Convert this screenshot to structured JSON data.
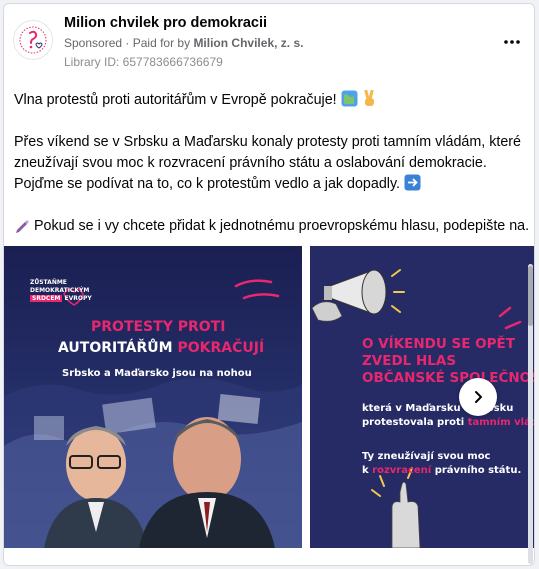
{
  "header": {
    "page_name": "Milion chvilek pro demokracii",
    "sponsored": "Sponsored",
    "paid_for_prefix": "Paid for by",
    "paid_for_name": "Milion Chvilek, z. s.",
    "library_id": "Library ID: 657783666736679",
    "more_icon": "more-horizontal-icon"
  },
  "post": {
    "line1": "Vlna protestů proti autoritářům v Evropě pokračuje!",
    "para2": "Přes víkend se v Srbsku a Maďarsku konaly protesty proti tamním vládám, které zneužívají svou moc k rozvracení právního státu a oslabování demokracie. Pojďme se podívat na to, co k protestům vedlo a jak dopadly.",
    "para3": "Pokud se i vy chcete přidat k jednotnému proevropskému hlasu, podepište na..."
  },
  "slide1": {
    "logo_line1": "ZŮSTAŇME",
    "logo_line2": "DEMOKRATICKÝM",
    "logo_line3_highlight": "SRDCEM",
    "logo_line3_rest": "EVROPY",
    "headline1": "PROTESTY PROTI",
    "headline2_white": "AUTORITÁŘŮM",
    "headline2_pink": "POKRAČUJÍ",
    "subhead": "Srbsko a Maďarsko jsou na nohou"
  },
  "slide2": {
    "headline1": "O VÍKENDU SE OPĚT",
    "headline2": "ZVEDL HLAS",
    "headline3": "OBČANSKÉ SPOLEČNOS",
    "text1": "která v Maďarsku a Srbsku",
    "text2_white": "protestovala proti",
    "text2_pink": "tamním vládám",
    "text3": "Ty zneužívají svou moc",
    "text4_white": "k",
    "text4_pink": "rozvracení",
    "text4_rest": "právního státu."
  },
  "colors": {
    "brand_pink": "#e8276f",
    "slide_navy": "#1f2358",
    "meta_gray": "#65676b"
  }
}
